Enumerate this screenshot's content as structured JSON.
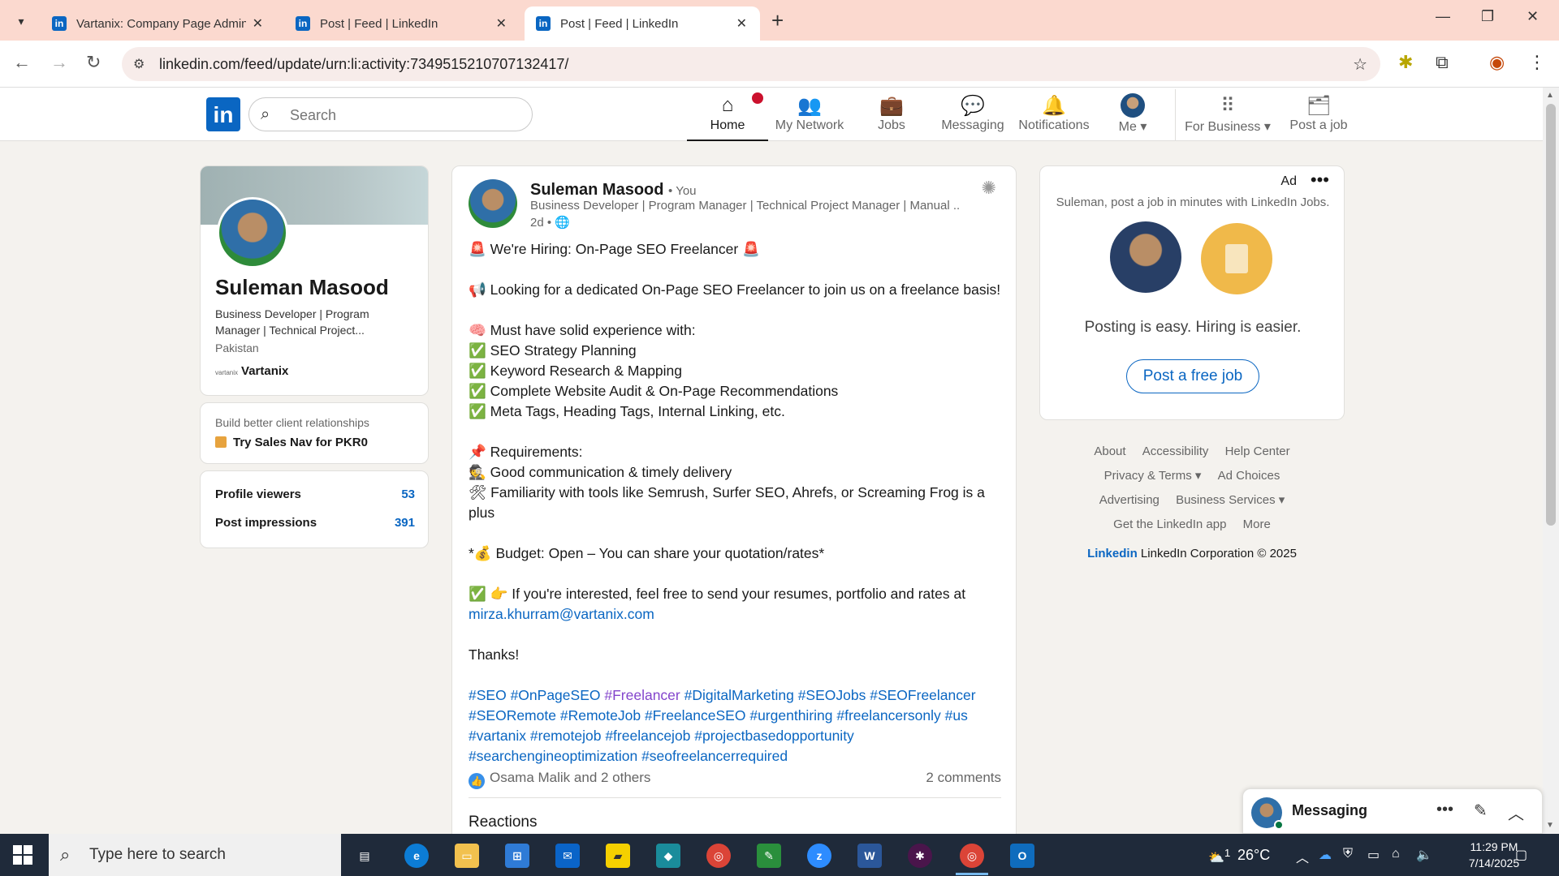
{
  "browser": {
    "tabs": [
      {
        "title": "Vartanix: Company Page Admin",
        "active": false
      },
      {
        "title": "Post | Feed | LinkedIn",
        "active": false
      },
      {
        "title": "Post | Feed | LinkedIn",
        "active": true
      }
    ],
    "url": "linkedin.com/feed/update/urn:li:activity:7349515210707132417/"
  },
  "header": {
    "search_placeholder": "Search",
    "nav": [
      {
        "label": "Home",
        "icon": "home-icon"
      },
      {
        "label": "My Network",
        "icon": "network-icon"
      },
      {
        "label": "Jobs",
        "icon": "briefcase-icon"
      },
      {
        "label": "Messaging",
        "icon": "chat-icon"
      },
      {
        "label": "Notifications",
        "icon": "bell-icon"
      },
      {
        "label": "Me",
        "icon": "avatar"
      },
      {
        "label": "For Business",
        "icon": "grid-icon"
      },
      {
        "label": "Post a job",
        "icon": "post-job-icon"
      }
    ]
  },
  "profile": {
    "name": "Suleman Masood",
    "headline": "Business Developer | Program Manager | Technical Project...",
    "location": "Pakistan",
    "company": "Vartanix",
    "company_logo_text": "vartanix"
  },
  "salesnav": {
    "line1": "Build better client relationships",
    "line2": "Try Sales Nav for PKR0"
  },
  "stats": [
    {
      "label": "Profile viewers",
      "value": "53"
    },
    {
      "label": "Post impressions",
      "value": "391"
    }
  ],
  "post": {
    "author": "Suleman Masood",
    "you_label": "• You",
    "author_headline": "Business Developer | Program Manager | Technical Project Manager | Manual ...",
    "time": "2d •",
    "lines": {
      "l1": "🚨 We're Hiring: On-Page SEO Freelancer 🚨",
      "l2": "📢 Looking for a dedicated On-Page SEO Freelancer to join us on a freelance basis!",
      "l3": "🧠 Must have solid experience with:",
      "l4": "✅ SEO Strategy Planning",
      "l5": "✅ Keyword Research & Mapping",
      "l6": "✅ Complete Website Audit & On-Page Recommendations",
      "l7": "✅ Meta Tags, Heading Tags, Internal Linking, etc.",
      "l8": "📌 Requirements:",
      "l9": "🕵 Good communication & timely delivery",
      "l10": "🛠 Familiarity with tools like Semrush, Surfer SEO, Ahrefs, or Screaming Frog is a plus",
      "l11": "*💰 Budget: Open – You can share your quotation/rates*",
      "l12": "✅ 👉 If you're interested, feel free to send your resumes, portfolio and rates at ",
      "email": "mirza.khurram@vartanix.com",
      "l13": "Thanks!"
    },
    "hashtags": [
      "#SEO",
      "#OnPageSEO",
      "#Freelancer",
      "#DigitalMarketing",
      "#SEOJobs",
      "#SEOFreelancer",
      "#SEORemote",
      "#RemoteJob",
      "#FreelanceSEO",
      "#urgenthiring",
      "#freelancersonly",
      "#us",
      "#vartanix",
      "#remotejob",
      "#freelancejob",
      "#projectbasedopportunity",
      "#searchengineoptimization",
      "#seofreelancerrequired"
    ],
    "reactions": "Osama Malik and 2 others",
    "comments": "2 comments",
    "reactions_title": "Reactions"
  },
  "ad": {
    "label": "Ad",
    "text": "Suleman, post a job in minutes with LinkedIn Jobs.",
    "tagline": "Posting is easy. Hiring is easier.",
    "button": "Post a free job"
  },
  "footer": {
    "row1": [
      "About",
      "Accessibility",
      "Help Center"
    ],
    "row2": [
      "Privacy & Terms ▾",
      "Ad Choices"
    ],
    "row3": [
      "Advertising",
      "Business Services ▾"
    ],
    "row4": [
      "Get the LinkedIn app",
      "More"
    ],
    "copyright_logo": "Linked",
    "copyright": "LinkedIn Corporation © 2025"
  },
  "messaging": {
    "label": "Messaging"
  },
  "taskbar": {
    "search_placeholder": "Type here to search",
    "weather": "26°C",
    "time": "11:29 PM",
    "date": "7/14/2025",
    "weather_badge": "1"
  },
  "colors": {
    "linkedin_blue": "#0a66c2",
    "tabbar": "#fbd9cf",
    "taskbar": "#1f2a3a",
    "notification_red": "#cb112d",
    "visited_hashtag": "#8344cc"
  }
}
